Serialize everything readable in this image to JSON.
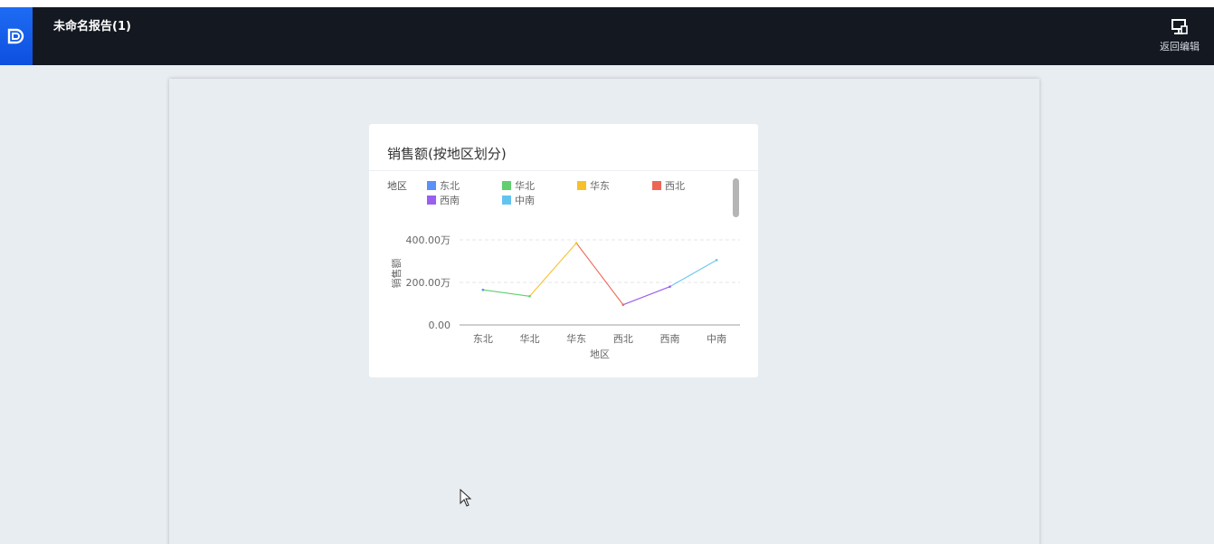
{
  "header": {
    "report_title": "未命名报告(1)",
    "back_button_label": "返回编辑"
  },
  "card": {
    "title": "销售额(按地区划分)"
  },
  "chart_data": {
    "type": "line",
    "legend_title": "地区",
    "legend_placement": "top",
    "categories": [
      "东北",
      "华北",
      "华东",
      "西北",
      "西南",
      "中南"
    ],
    "values": [
      1650000,
      1350000,
      3850000,
      950000,
      1800000,
      3050000
    ],
    "colors": [
      "#5b8ff9",
      "#5fcf6f",
      "#f7c02b",
      "#ee6555",
      "#9a5ff0",
      "#63c3f0"
    ],
    "xlabel": "地区",
    "ylabel": "销售额",
    "ylim": [
      0,
      4000000
    ],
    "yticks": [
      {
        "value": 0,
        "label": "0.00"
      },
      {
        "value": 2000000,
        "label": "200.00万"
      },
      {
        "value": 4000000,
        "label": "400.00万"
      }
    ],
    "grid": true
  }
}
